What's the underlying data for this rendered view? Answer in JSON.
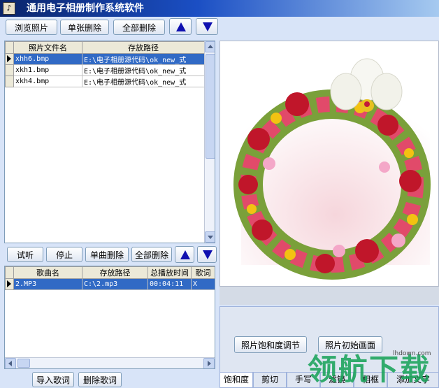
{
  "window": {
    "title": "通用电子相册制作系统软件",
    "icon_glyph": "♪"
  },
  "photo_toolbar": {
    "browse": "浏览照片",
    "delete_one": "单张删除",
    "delete_all": "全部删除"
  },
  "photo_table": {
    "headers": [
      "照片文件名",
      "存放路径"
    ],
    "rows": [
      {
        "name": "xhh6.bmp",
        "path": "E:\\电子相册源代码\\ok_new_式",
        "selected": true
      },
      {
        "name": "xkh1.bmp",
        "path": "E:\\电子相册源代码\\ok_new_式",
        "selected": false
      },
      {
        "name": "xkh4.bmp",
        "path": "E:\\电子相册源代码\\ok_new_式",
        "selected": false
      }
    ]
  },
  "music_toolbar": {
    "listen": "试听",
    "stop": "停止",
    "delete_one": "单曲删除",
    "delete_all": "全部删除"
  },
  "music_table": {
    "headers": [
      "歌曲名",
      "存放路径",
      "总播放时间",
      "歌词"
    ],
    "rows": [
      {
        "name": "2.MP3",
        "path": "C:\\2.mp3",
        "duration": "00:04:11",
        "lyrics": "X",
        "selected": true
      }
    ]
  },
  "lyrics_toolbar": {
    "import": "导入歌词",
    "delete": "删除歌词"
  },
  "effect_panel": {
    "saturation_btn": "照片饱和度调节",
    "original_btn": "照片初始画面"
  },
  "tabs": [
    "饱和度",
    "剪切",
    "手写",
    "滤镜",
    "相框",
    "添加文字"
  ],
  "watermark": {
    "big": "领航下载",
    "small": "lhdown.com"
  },
  "colors": {
    "selection": "#316ac5",
    "title_start": "#0a246a",
    "title_end": "#a6caf0",
    "arrow_blue": "#1010b0",
    "arrow_red": "#c01010"
  },
  "icons": [
    "app-icon",
    "up-arrow-icon",
    "down-arrow-icon",
    "row-marker-icon"
  ]
}
